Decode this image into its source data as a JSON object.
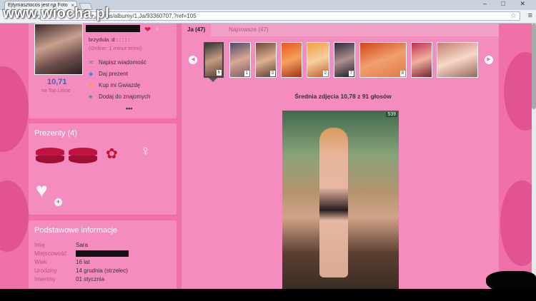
{
  "browser": {
    "tab_title": "Ejtymasztocos jest na Foto",
    "url": "ps/albumy/1,Ja/93360707,?ref=105",
    "window_controls": "– □ ✕",
    "watermark": "www.wiocha.pl"
  },
  "profile": {
    "status_text": "brzydula :d : : : : :",
    "online_text": "(Online: 1 minut temu)",
    "rating": "10,71",
    "rating_sub": "na Top Liście",
    "actions": [
      {
        "label": "Napisz wiadomość",
        "icon": "envelope-icon"
      },
      {
        "label": "Daj prezent",
        "icon": "gift-icon"
      },
      {
        "label": "Kup mi Gwiazdę",
        "icon": "star-icon"
      },
      {
        "label": "Dodaj do znajomych",
        "icon": "friends-icon"
      }
    ],
    "more": "•••"
  },
  "gifts": {
    "title": "Prezenty (4)",
    "items": [
      "lips",
      "lips",
      "roses",
      "figure",
      "diamond-heart"
    ]
  },
  "info": {
    "title": "Podstawowe informacje",
    "rows": [
      {
        "label": "Imię",
        "value": "Sara"
      },
      {
        "label": "Miejscowość",
        "value": ""
      },
      {
        "label": "Wiek",
        "value": "16 lat"
      },
      {
        "label": "Urodziny",
        "value": "14 grudnia (strzelec)"
      },
      {
        "label": "Imieniny",
        "value": "01 stycznia"
      }
    ]
  },
  "album": {
    "tabs": [
      {
        "label": "Ja (47)",
        "active": true
      },
      {
        "label": "Najnowsze (47)",
        "active": false
      }
    ],
    "thumb_badges": [
      "6",
      "1",
      "3",
      "",
      "2",
      "7",
      "8",
      "",
      ""
    ],
    "average_text": "Średnia zdjęcia 10,78 z 91 głosów",
    "view_count": "539"
  },
  "colors": {
    "page_bg": "#f070a8",
    "card_bg": "#f58cc0",
    "link_pink": "#c44b85"
  }
}
